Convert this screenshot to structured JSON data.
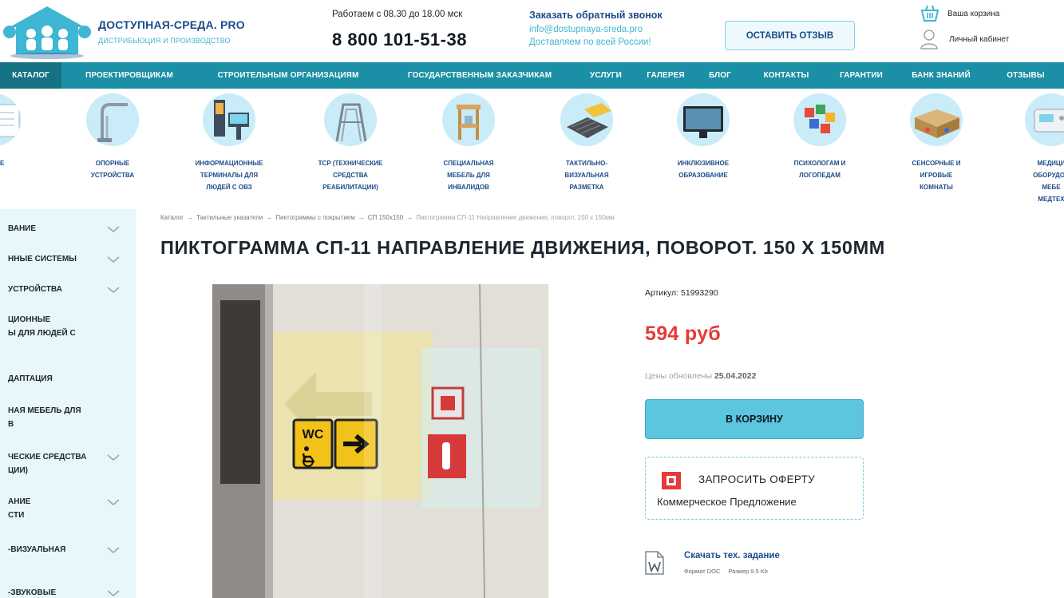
{
  "header": {
    "brand_name": "ДОСТУПНАЯ-СРЕДА. PRO",
    "brand_tagline": "ДИСТРИБЬЮЦИЯ И ПРОИЗВОДСТВО",
    "hours": "Работаем с 08.30 до 18.00 мск",
    "phone": "8 800 101-51-38",
    "callback_label": "Заказать обратный звонок",
    "email": "info@dostupnaya-sreda.pro",
    "delivery": "Доставляем по всей России!",
    "review_button": "ОСТАВИТЬ ОТЗЫВ",
    "cart_label": "Ваша корзина",
    "account_label": "Личный кабинет"
  },
  "nav": {
    "items": [
      "КАТАЛОГ",
      "ПРОЕКТИРОВЩИКАМ",
      "СТРОИТЕЛЬНЫМ ОРГАНИЗАЦИЯМ",
      "ГОСУДАРСТВЕННЫМ ЗАКАЗЧИКАМ",
      "УСЛУГИ",
      "ГАЛЕРЕЯ",
      "БЛОГ",
      "КОНТАКТЫ",
      "ГАРАНТИИ",
      "БАНК ЗНАНИЙ",
      "ОТЗЫВЫ"
    ]
  },
  "categories": [
    {
      "label": "…ННЫЕ …Ы",
      "lines": [
        "ННЫЕ",
        "Ы"
      ]
    },
    {
      "label": "ОПОРНЫЕ УСТРОЙСТВА",
      "lines": [
        "ОПОРНЫЕ",
        "УСТРОЙСТВА"
      ]
    },
    {
      "label": "ИНФОРМАЦИОННЫЕ ТЕРМИНАЛЫ ДЛЯ ЛЮДЕЙ С ОВЗ",
      "lines": [
        "ИНФОРМАЦИОННЫЕ",
        "ТЕРМИНАЛЫ ДЛЯ",
        "ЛЮДЕЙ С ОВЗ"
      ]
    },
    {
      "label": "ТСР (ТЕХНИЧЕСКИЕ СРЕДСТВА РЕАБИЛИТАЦИИ)",
      "lines": [
        "ТСР (ТЕХНИЧЕСКИЕ",
        "СРЕДСТВА",
        "РЕАБИЛИТАЦИИ)"
      ]
    },
    {
      "label": "СПЕЦИАЛЬНАЯ МЕБЕЛЬ ДЛЯ ИНВАЛИДОВ",
      "lines": [
        "СПЕЦИАЛЬНАЯ",
        "МЕБЕЛЬ ДЛЯ",
        "ИНВАЛИДОВ"
      ]
    },
    {
      "label": "ТАКТИЛЬНО-ВИЗУАЛЬНАЯ РАЗМЕТКА",
      "lines": [
        "ТАКТИЛЬНО-",
        "ВИЗУАЛЬНАЯ",
        "РАЗМЕТКА"
      ]
    },
    {
      "label": "ИНКЛЮЗИВНОЕ ОБРАЗОВАНИЕ",
      "lines": [
        "ИНКЛЮЗИВНОЕ",
        "ОБРАЗОВАНИЕ"
      ]
    },
    {
      "label": "ПСИХОЛОГАМ И ЛОГОПЕДАМ",
      "lines": [
        "ПСИХОЛОГАМ И",
        "ЛОГОПЕДАМ"
      ]
    },
    {
      "label": "СЕНСОРНЫЕ И ИГРОВЫЕ КОМНАТЫ",
      "lines": [
        "СЕНСОРНЫЕ И",
        "ИГРОВЫЕ",
        "КОМНАТЫ"
      ]
    },
    {
      "label": "МЕДИЦИ… ОБОРУДО… МЕБЕ… МЕДТЕХ…",
      "lines": [
        "МЕДИЦИ",
        "ОБОРУДОВ",
        "МЕБЕ",
        "МЕДТЕХ"
      ]
    }
  ],
  "sidebar": {
    "items": [
      {
        "lines": [
          "ВАНИЕ"
        ],
        "chevron": true
      },
      {
        "lines": [
          "ННЫЕ СИСТЕМЫ"
        ],
        "chevron": true
      },
      {
        "lines": [
          "УСТРОЙСТВА"
        ],
        "chevron": true
      },
      {
        "lines": [
          "ЦИОННЫЕ",
          "Ы ДЛЯ ЛЮДЕЙ С"
        ],
        "chevron": false
      },
      {
        "lines": [
          "ДАПТАЦИЯ"
        ],
        "chevron": false
      },
      {
        "lines": [
          "НАЯ МЕБЕЛЬ ДЛЯ",
          "В"
        ],
        "chevron": false
      },
      {
        "lines": [
          "ЧЕСКИЕ СРЕДСТВА",
          "ЦИИ)"
        ],
        "chevron": true
      },
      {
        "lines": [
          "АНИЕ",
          "СТИ"
        ],
        "chevron": true
      },
      {
        "lines": [
          "-ВИЗУАЛЬНАЯ"
        ],
        "chevron": true
      },
      {
        "lines": [
          "-ЗВУКОВЫЕ"
        ],
        "chevron": true
      }
    ]
  },
  "breadcrumb": {
    "items": [
      "Каталог",
      "Тактильные указатели",
      "Пиктограммы с покрытием",
      "СП 150х150"
    ],
    "current": "Пиктограмма СП-11 Направление движения, поворот. 150 х 150мм",
    "separator": "→"
  },
  "product": {
    "title": "ПИКТОГРАММА СП-11 НАПРАВЛЕНИЕ ДВИЖЕНИЯ, ПОВОРОТ. 150 Х 150ММ",
    "sku_label": "Артикул:",
    "sku": "51993290",
    "price": "594 руб",
    "updated_label": "Цены обновлены",
    "updated_date": "25.04.2022",
    "buy_button": "В КОРЗИНУ",
    "offer_title": "ЗАПРОСИТЬ ОФЕРТУ",
    "offer_sub": "Коммерческое Предложение",
    "doc_link": "Скачать тех. задание",
    "doc_format": "Формат DOC",
    "doc_size": "Размер 9.5 Kb",
    "photo_sign_text": "WC"
  },
  "colors": {
    "nav_bg": "#1a8fa5",
    "brand_blue": "#1b4c8a",
    "accent_cyan": "#3fb6d4",
    "price_red": "#e63a3a",
    "button_cyan": "#5bc6de",
    "sidebar_bg": "#e8f7fc"
  },
  "icons": {
    "logo": "house-family-logo",
    "cart": "basket-icon",
    "account": "user-icon",
    "chevron": "chevron-down-icon",
    "offer": "offer-square-icon",
    "doc": "word-doc-icon"
  }
}
